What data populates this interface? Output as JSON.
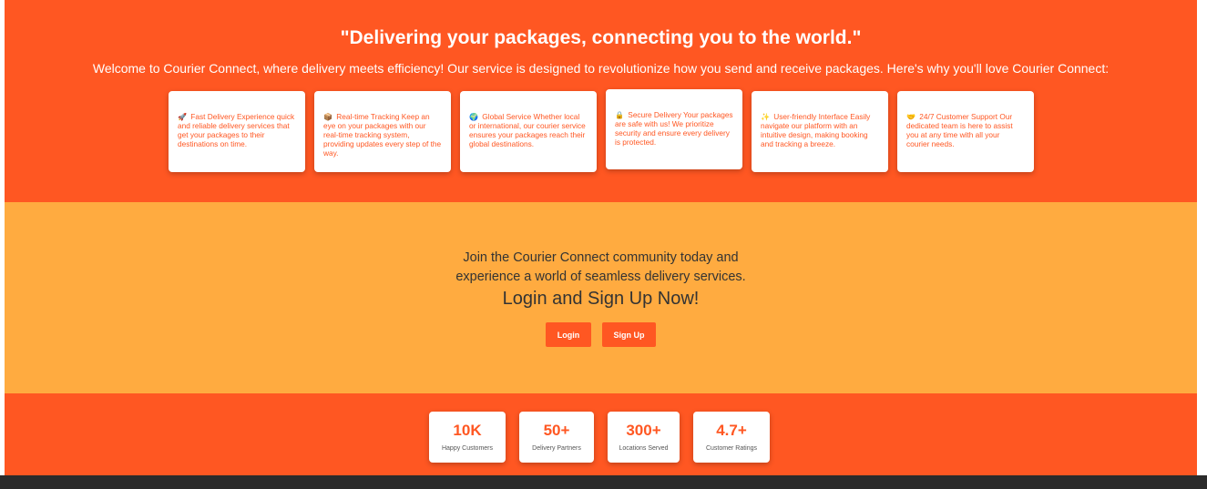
{
  "hero": {
    "title": "\"Delivering your packages, connecting you to the world.\"",
    "intro": "Welcome to Courier Connect, where delivery meets efficiency! Our service is designed to revolutionize how you send and receive packages. Here's why you'll love Courier Connect:"
  },
  "features": [
    {
      "emoji": "🚀",
      "text": "Fast Delivery Experience quick and reliable delivery services that get your packages to their destinations on time."
    },
    {
      "emoji": "📦",
      "text": "Real-time Tracking Keep an eye on your packages with our real-time tracking system, providing updates every step of the way."
    },
    {
      "emoji": "🌍",
      "text": "Global Service Whether local or international, our courier service ensures your packages reach their global destinations."
    },
    {
      "emoji": "🔒",
      "text": "Secure Delivery Your packages are safe with us! We prioritize security and ensure every delivery is protected."
    },
    {
      "emoji": "✨",
      "text": "User-friendly Interface Easily navigate our platform with an intuitive design, making booking and tracking a breeze."
    },
    {
      "emoji": "🤝",
      "text": "24/7 Customer Support Our dedicated team is here to assist you at any time with all your courier needs."
    }
  ],
  "cta": {
    "text": "Join the Courier Connect community today and experience a world of seamless delivery services.",
    "heading": "Login and Sign Up Now!",
    "login_label": "Login",
    "signup_label": "Sign Up"
  },
  "stats": [
    {
      "value": "10K",
      "label": "Happy Customers"
    },
    {
      "value": "50+",
      "label": "Delivery Partners"
    },
    {
      "value": "300+",
      "label": "Locations Served"
    },
    {
      "value": "4.7+",
      "label": "Customer Ratings"
    }
  ],
  "colors": {
    "primary": "#ff5722",
    "secondary": "#ffab40",
    "text_dark": "#333333",
    "footer": "#2b2b2b"
  }
}
